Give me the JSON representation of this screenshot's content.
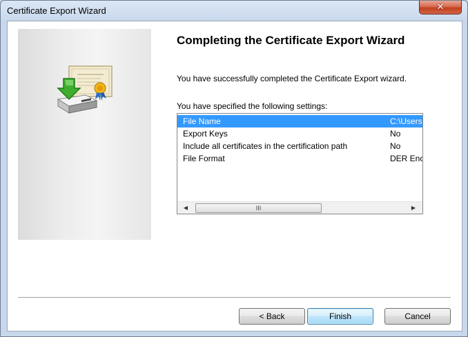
{
  "window": {
    "title": "Certificate Export Wizard",
    "close_label": "✕"
  },
  "page": {
    "heading": "Completing the Certificate Export Wizard",
    "success_message": "You have successfully completed the Certificate Export wizard.",
    "settings_label": "You have specified the following settings:"
  },
  "settings": {
    "rows": [
      {
        "name": "File Name",
        "value": "C:\\Users",
        "selected": true
      },
      {
        "name": "Export Keys",
        "value": "No",
        "selected": false
      },
      {
        "name": "Include all certificates in the certification path",
        "value": "No",
        "selected": false
      },
      {
        "name": "File Format",
        "value": "DER Encoded",
        "selected": false
      }
    ],
    "scroll_left_icon": "scroll-left-arrow",
    "scroll_right_icon": "scroll-right-arrow",
    "scroll_grip": "III"
  },
  "buttons": {
    "back": "< Back",
    "finish": "Finish",
    "cancel": "Cancel"
  },
  "colors": {
    "selection": "#3399ff",
    "close_button": "#c0401f"
  }
}
